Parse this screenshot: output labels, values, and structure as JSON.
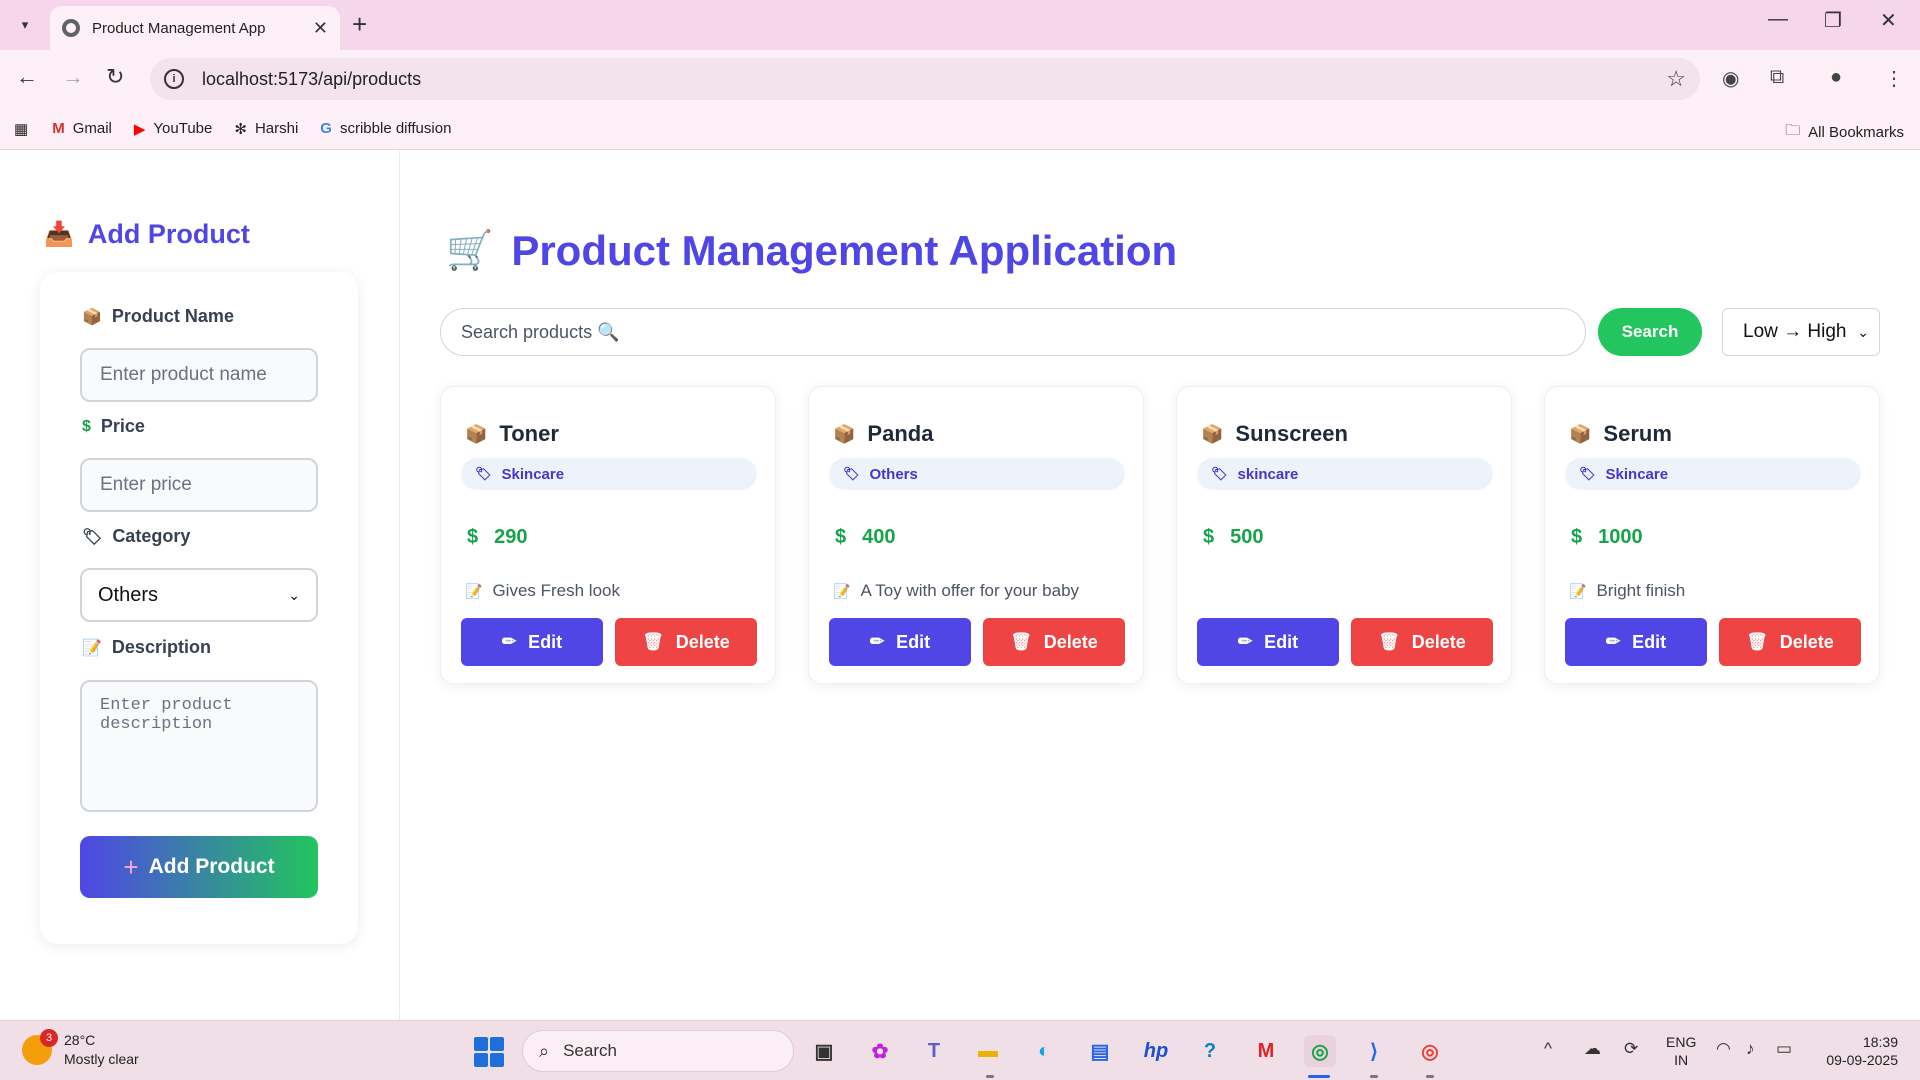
{
  "browser": {
    "tab_title": "Product Management App",
    "url": "localhost:5173/api/products",
    "bookmarks": [
      {
        "label": "Gmail",
        "icon": "gmail-icon"
      },
      {
        "label": "YouTube",
        "icon": "youtube-icon"
      },
      {
        "label": "Harshi",
        "icon": "openai-icon"
      },
      {
        "label": "scribble diffusion",
        "icon": "google-icon"
      }
    ],
    "all_bookmarks": "All Bookmarks"
  },
  "sidebar": {
    "title": "Add Product",
    "title_icon": "inbox-tray-icon",
    "fields": {
      "name_label": "Product Name",
      "name_placeholder": "Enter product name",
      "price_label": "Price",
      "price_placeholder": "Enter price",
      "category_label": "Category",
      "category_value": "Others",
      "description_label": "Description",
      "description_placeholder": "Enter product description"
    },
    "add_button": "Add Product"
  },
  "main": {
    "title": "Product Management Application",
    "title_icon": "shopping-cart-icon",
    "search_placeholder": "Search products 🔍",
    "search_button": "Search",
    "sort_value": "Low → High",
    "edit_label": "Edit",
    "delete_label": "Delete",
    "products": [
      {
        "name": "Toner",
        "category": "Skincare",
        "price": "290",
        "description": "Gives Fresh look"
      },
      {
        "name": "Panda",
        "category": "Others",
        "price": "400",
        "description": "A Toy with offer for your baby"
      },
      {
        "name": "Sunscreen",
        "category": "skincare",
        "price": "500",
        "description": ""
      },
      {
        "name": "Serum",
        "category": "Skincare",
        "price": "1000",
        "description": "Bright finish"
      }
    ]
  },
  "taskbar": {
    "temperature": "28°C",
    "weather": "Mostly clear",
    "weather_badge": "3",
    "search": "Search",
    "lang_1": "ENG",
    "lang_2": "IN",
    "time": "18:39",
    "date": "09-09-2025"
  },
  "colors": {
    "accent": "#4f46e5",
    "success": "#22c55e",
    "danger": "#ef4444",
    "price": "#16a34a",
    "chrome": "#f6d6ea"
  }
}
